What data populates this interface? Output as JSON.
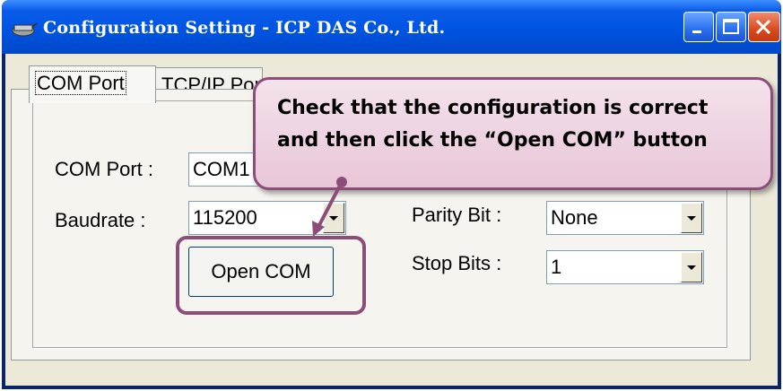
{
  "window": {
    "title": "Configuration Setting - ICP DAS Co., Ltd.",
    "icon": "app-icon",
    "controls": [
      "minimize-icon",
      "maximize-icon",
      "close-icon"
    ]
  },
  "tabs": [
    {
      "label": "COM Port",
      "active": true
    },
    {
      "label": "TCP/IP Port",
      "active": false
    }
  ],
  "form": {
    "com_port_label": "COM Port :",
    "com_port_value": "COM1",
    "baudrate_label": "Baudrate :",
    "baudrate_value": "115200",
    "parity_label": "Parity Bit :",
    "parity_value": "None",
    "stop_bits_label": "Stop Bits :",
    "stop_bits_value": "1",
    "open_button": "Open COM"
  },
  "callout": {
    "line1": "Check that the configuration is correct",
    "line2": "and then click the “Open COM” button"
  },
  "colors": {
    "titlebar": "#0054e3",
    "close_button": "#d9491e",
    "callout_border": "#8b4e78",
    "callout_fill": "#ecd3e1",
    "window_bg": "#ece9d8"
  }
}
